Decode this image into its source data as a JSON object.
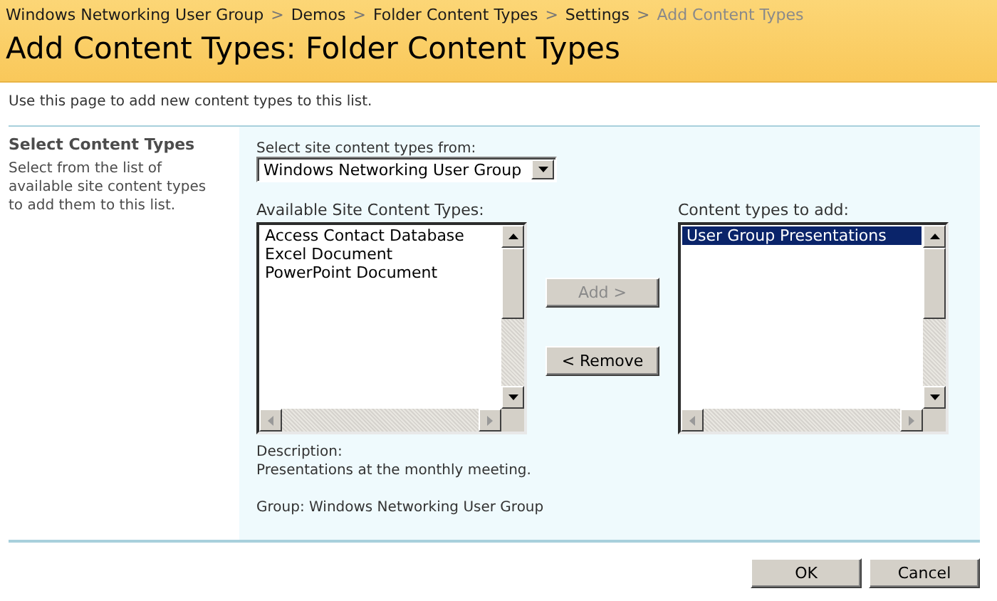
{
  "breadcrumb": [
    {
      "label": "Windows Networking User Group",
      "current": false
    },
    {
      "label": "Demos",
      "current": false
    },
    {
      "label": "Folder Content Types",
      "current": false
    },
    {
      "label": "Settings",
      "current": false
    },
    {
      "label": "Add Content Types",
      "current": true
    }
  ],
  "breadcrumb_separator": ">",
  "title": "Add Content Types: Folder Content Types",
  "intro": "Use this page to add new content types to this list.",
  "section": {
    "title": "Select Content Types",
    "description": "Select from the list of available site content types to add them to this list."
  },
  "source": {
    "label": "Select site content types from:",
    "value": "Windows Networking User Group"
  },
  "available": {
    "label": "Available Site Content Types:",
    "items": [
      {
        "label": "Access Contact Database",
        "selected": false
      },
      {
        "label": "Excel Document",
        "selected": false
      },
      {
        "label": "PowerPoint Document",
        "selected": false
      }
    ]
  },
  "move_buttons": [
    {
      "label": "Add >",
      "disabled": true
    },
    {
      "label": "< Remove",
      "disabled": false
    }
  ],
  "to_add": {
    "label": "Content types to add:",
    "items": [
      {
        "label": "User Group Presentations",
        "selected": true
      }
    ]
  },
  "details": {
    "label": "Description:",
    "text": "Presentations at the monthly meeting.",
    "group": "Group: Windows Networking User Group"
  },
  "buttons": [
    {
      "label": "OK"
    },
    {
      "label": "Cancel"
    }
  ]
}
